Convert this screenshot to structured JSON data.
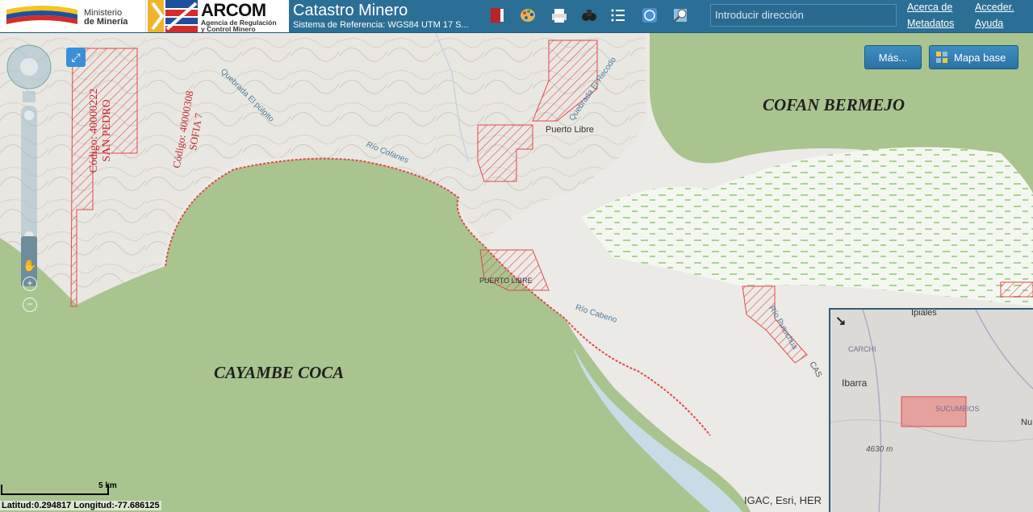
{
  "header": {
    "ministry_line1": "Ministerio",
    "ministry_line2": "de Minería",
    "arcom_title": "ARCOM",
    "arcom_sub1": "Agencia de Regulación",
    "arcom_sub2": "y Control Minero",
    "app_title": "Catastro Minero",
    "app_subtitle": "Sistema de Referencia: WGS84 UTM 17 S...",
    "search_placeholder": "Introducir dirección",
    "links": {
      "about_line1": "Acerca de",
      "about_line2": "Metadatos",
      "access": "Acceder.",
      "help": "Ayuda"
    },
    "tools": [
      "book-icon",
      "palette-icon",
      "printer-icon",
      "binoculars-icon",
      "list-icon",
      "globe-icon",
      "zoom-map-icon"
    ]
  },
  "map": {
    "buttons": {
      "more": "Más...",
      "basemap": "Mapa base"
    },
    "labels": {
      "cofan": "COFAN BERMEJO",
      "cayambe": "CAYAMBE COCA",
      "puerto_libre": "Puerto Libre",
      "puerto_libre_small": "PUERTO LIBRE",
      "rio_cofanes": "Río Cofanes",
      "rio_cabeno": "Río Cabeno",
      "rio_putuchua": "Río Putuchua",
      "cas": "CAS",
      "quebrada_pulpito": "Quebrada El púlpito",
      "quebrada_recodo": "Quebrada El Recodo",
      "concession_1": "Código: 40000222 SAN PEDRO",
      "concession_2": "Código: 40000308 SOFIA 7"
    },
    "scale": "5 km",
    "coords": "Latitud:0.294817  Longitud:-77.686125",
    "attribution": "IGAC, Esri, HER",
    "overview": {
      "ipiales": "Ipiales",
      "carchi": "CARCHI",
      "ibarra": "Ibarra",
      "sucumbios": "SUCUMBIOS",
      "elevation": "4630 m",
      "nu": "Nu"
    }
  },
  "colors": {
    "header": "#2b6f96",
    "protected_area": "#a9c48f",
    "concession": "#e0494b"
  }
}
